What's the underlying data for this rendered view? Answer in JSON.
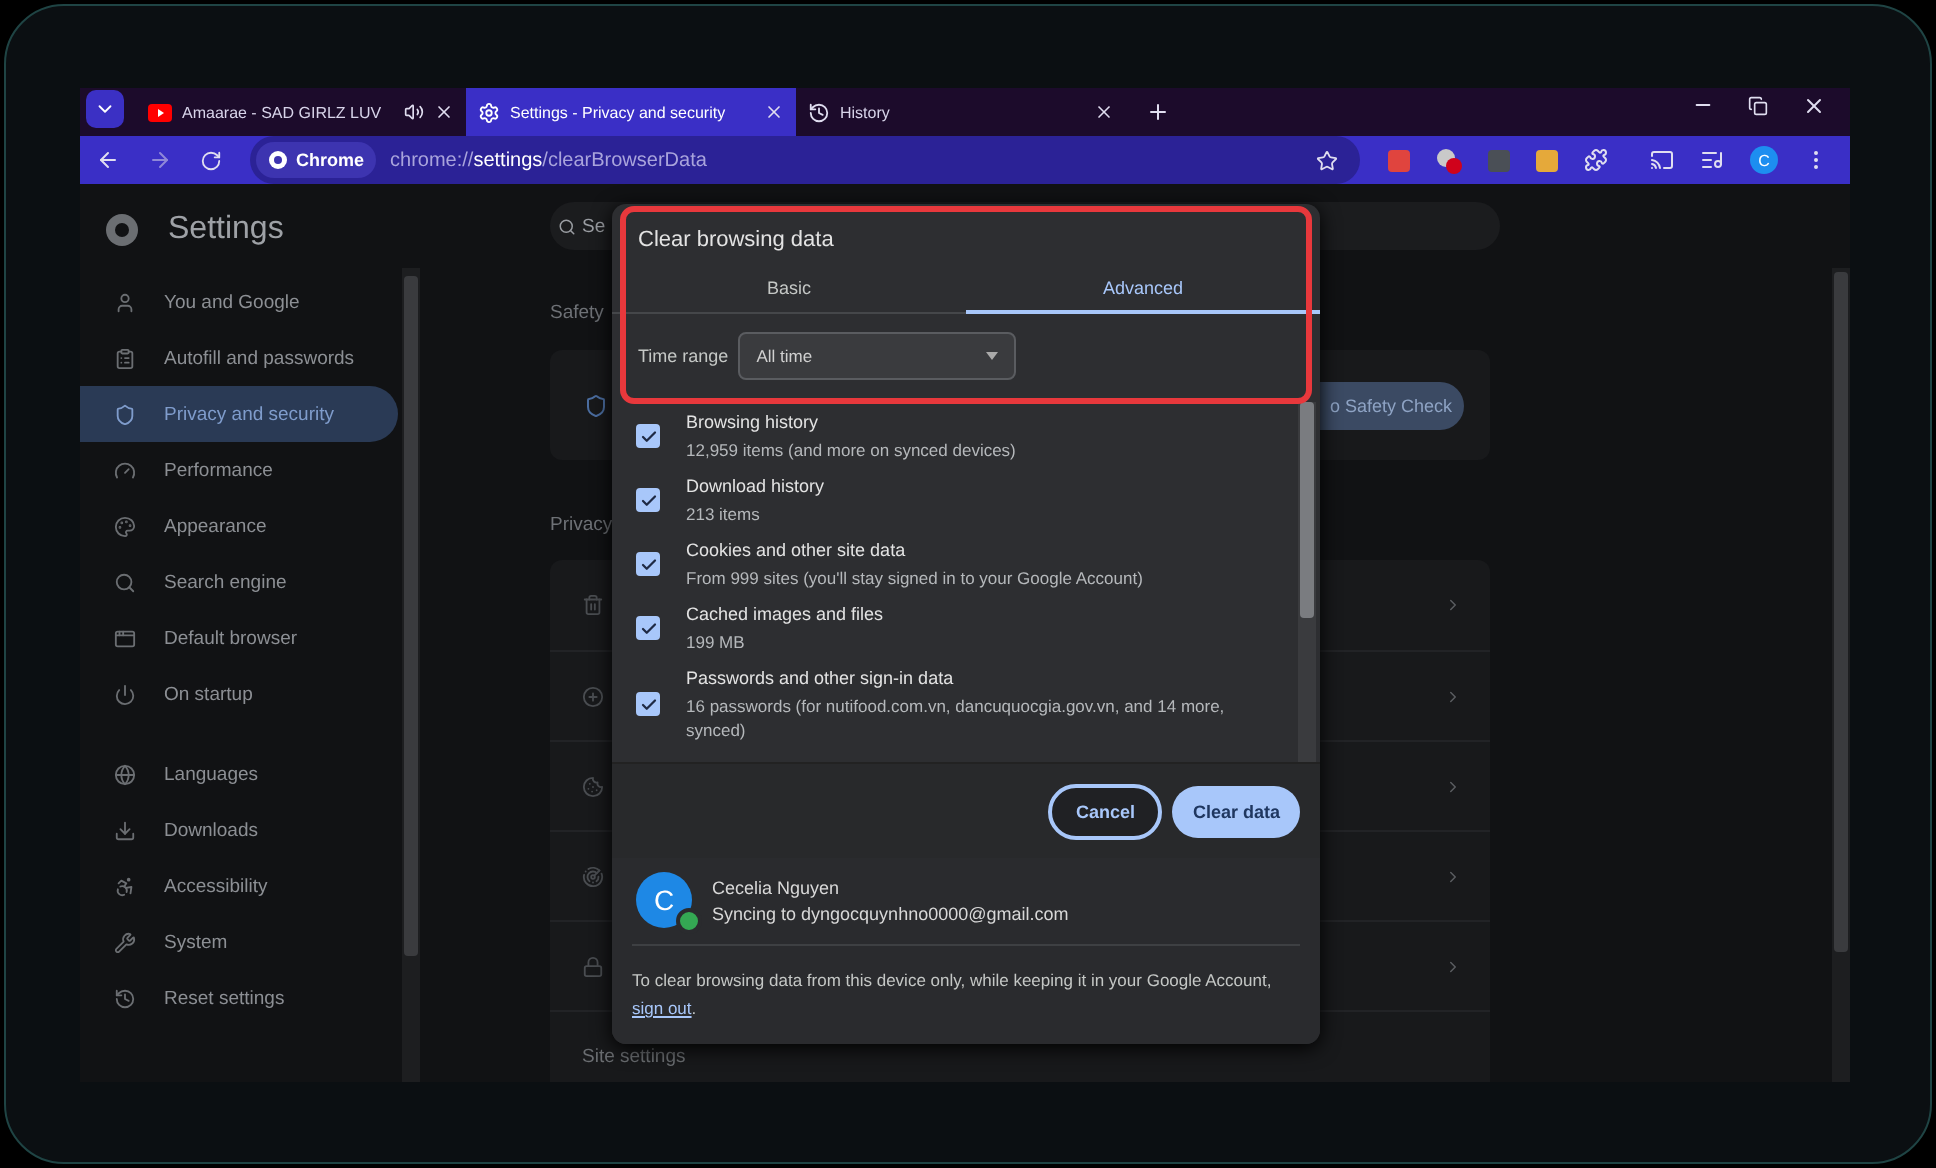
{
  "tabs": [
    {
      "title": "Amaarae - SAD GIRLZ LUV",
      "selected": false,
      "audio": true,
      "kind": "video"
    },
    {
      "title": "Settings - Privacy and security",
      "selected": true,
      "audio": false,
      "kind": "settings"
    },
    {
      "title": "History",
      "selected": false,
      "audio": false,
      "kind": "history"
    }
  ],
  "toolbar": {
    "site_chip": "Chrome",
    "url": "chrome://**settings**/clearBrowserData",
    "profile_initial": "C"
  },
  "sidebar": {
    "title": "Settings",
    "sections": [
      [
        {
          "label": "You and Google",
          "selected": false
        },
        {
          "label": "Autofill and passwords",
          "selected": false
        },
        {
          "label": "Privacy and security",
          "selected": true
        },
        {
          "label": "Performance",
          "selected": false
        },
        {
          "label": "Appearance",
          "selected": false
        },
        {
          "label": "Search engine",
          "selected": false
        },
        {
          "label": "Default browser",
          "selected": false
        },
        {
          "label": "On startup",
          "selected": false
        }
      ],
      [
        {
          "label": "Languages",
          "selected": false
        },
        {
          "label": "Downloads",
          "selected": false
        },
        {
          "label": "Accessibility",
          "selected": false
        },
        {
          "label": "System",
          "selected": false
        },
        {
          "label": "Reset settings",
          "selected": false
        }
      ]
    ]
  },
  "main": {
    "search_placeholder": "Se",
    "safety_heading": "Safety",
    "safety_button": "o Safety Check",
    "privacy_heading": "Privacy",
    "last_row": "Site settings"
  },
  "dialog": {
    "title": "Clear browsing data",
    "tabs": [
      {
        "label": "Basic",
        "selected": false
      },
      {
        "label": "Advanced",
        "selected": true
      }
    ],
    "time_range": {
      "label": "Time range",
      "value": "All time"
    },
    "items": [
      {
        "title": "Browsing history",
        "detail": "12,959 items (and more on synced devices)",
        "checked": true
      },
      {
        "title": "Download history",
        "detail": "213 items",
        "checked": true
      },
      {
        "title": "Cookies and other site data",
        "detail": "From 999 sites (you'll stay signed in to your Google Account)",
        "checked": true
      },
      {
        "title": "Cached images and files",
        "detail": "199 MB",
        "checked": true
      },
      {
        "title": "Passwords and other sign-in data",
        "detail": "16 passwords (for nutifood.com.vn, dancuquocgia.gov.vn, and 14 more, synced)",
        "checked": true
      }
    ],
    "buttons": {
      "cancel": "Cancel",
      "confirm": "Clear data"
    },
    "account": {
      "initial": "C",
      "name": "Cecelia Nguyen",
      "status": "Syncing to dyngocquynhno0000@gmail.com"
    },
    "note": {
      "text": "To clear browsing data from this device only, while keeping it in your Google Account, ",
      "link": "sign out",
      "after": "."
    }
  }
}
